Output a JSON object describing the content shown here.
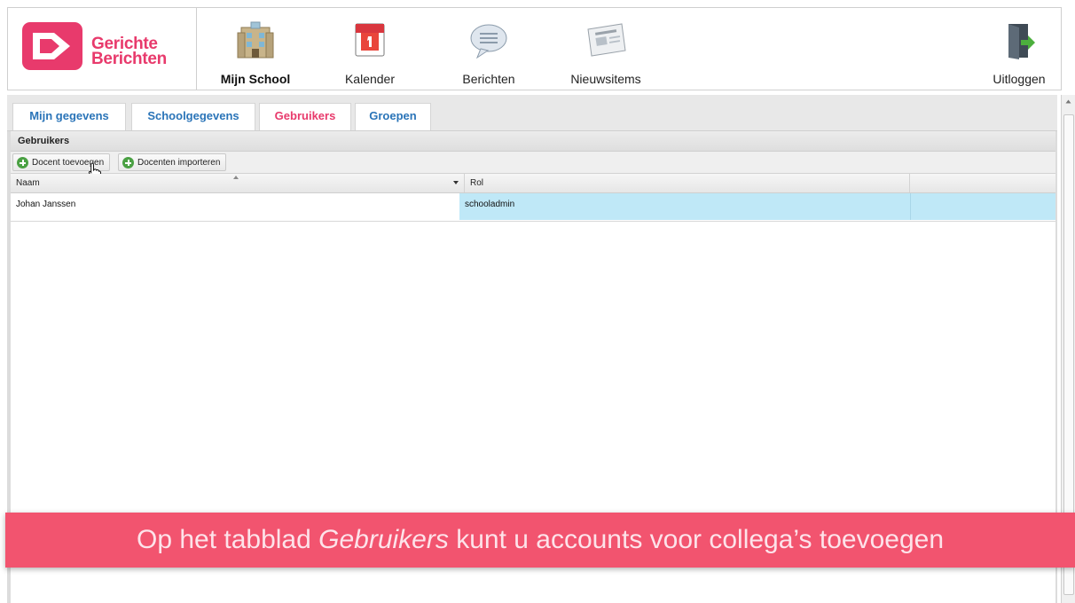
{
  "brand": {
    "line1": "Gerichte",
    "line2": "Berichten",
    "color": "#e83a6c"
  },
  "nav": [
    {
      "label": "Mijn School",
      "icon": "school-building-icon",
      "active": true
    },
    {
      "label": "Kalender",
      "icon": "calendar-icon"
    },
    {
      "label": "Berichten",
      "icon": "speech-bubble-icon"
    },
    {
      "label": "Nieuwsitems",
      "icon": "newspaper-icon"
    },
    {
      "label": "Uitloggen",
      "icon": "logout-door-icon"
    }
  ],
  "tabs": [
    {
      "label": "Mijn gegevens"
    },
    {
      "label": "Schoolgegevens"
    },
    {
      "label": "Gebruikers",
      "active": true
    },
    {
      "label": "Groepen"
    }
  ],
  "section": {
    "title": "Gebruikers"
  },
  "toolbar": {
    "add_label": "Docent toevoegen",
    "import_label": "Docenten importeren"
  },
  "grid": {
    "columns": [
      "Naam",
      "Rol"
    ],
    "rows": [
      {
        "naam": "Johan Janssen",
        "rol": "schooladmin"
      }
    ]
  },
  "caption": {
    "before": "Op het tabblad ",
    "emph": "Gebruikers",
    "after": " kunt u accounts voor collega’s toevoegen"
  },
  "colors": {
    "accent": "#e83a6c",
    "caption_bg": "#f2546f",
    "tab_link": "#2a74b8",
    "selected_cell": "#bfe8f7"
  }
}
